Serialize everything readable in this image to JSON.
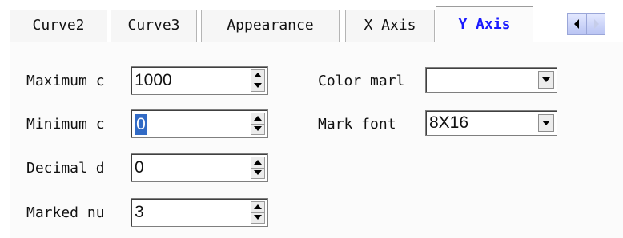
{
  "tabs": [
    {
      "label": "Curve2",
      "active": false
    },
    {
      "label": "Curve3",
      "active": false
    },
    {
      "label": "Appearance",
      "active": false
    },
    {
      "label": "X Axis",
      "active": false
    },
    {
      "label": "Y Axis",
      "active": true
    }
  ],
  "tab_scroll": {
    "left_icon": "arrow-left-icon",
    "right_icon": "arrow-right-icon"
  },
  "fields": {
    "maximum": {
      "label": "Maximum c",
      "value": "1000"
    },
    "minimum": {
      "label": "Minimum c",
      "value": "0"
    },
    "decimal": {
      "label": "Decimal d",
      "value": "0"
    },
    "marked": {
      "label": "Marked nu",
      "value": "3"
    },
    "color_mark": {
      "label": "Color marl",
      "value": ""
    },
    "mark_font": {
      "label": "Mark font",
      "value": "8X16"
    }
  },
  "colors": {
    "active_tab_text": "#1a1aff",
    "selection": "#316ac5"
  }
}
